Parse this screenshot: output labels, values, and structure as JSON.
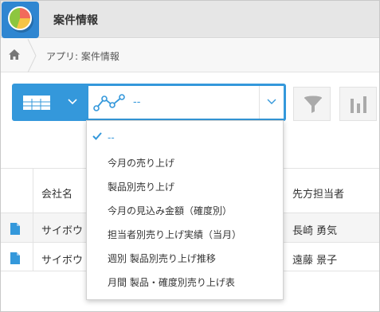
{
  "header": {
    "app_icon": "pie-chart-app-icon",
    "title": "案件情報"
  },
  "breadcrumb": {
    "home_icon": "home-icon",
    "text": "アプリ: 案件情報"
  },
  "toolbar": {
    "view_icon": "table-view-icon",
    "graph_icon": "line-chart-icon",
    "graph_value": "--",
    "filter_icon": "filter-icon",
    "chart_icon": "bar-chart-icon"
  },
  "table": {
    "headers": {
      "company": "会社名",
      "contact": "先方担当者"
    },
    "rows": [
      {
        "company": "サイボウ",
        "contact": "長崎 勇気"
      },
      {
        "company": "サイボウ",
        "contact": "遠藤 景子"
      }
    ]
  },
  "dropdown": {
    "items": [
      {
        "label": "--",
        "selected": true
      },
      {
        "label": "今月の売り上げ"
      },
      {
        "label": "製品別売り上げ"
      },
      {
        "label": "今月の見込み金額（確度別）"
      },
      {
        "label": "担当者別売り上げ実績（当月）"
      },
      {
        "label": "週別 製品別売り上げ推移"
      },
      {
        "label": "月間 製品・確度別売り上げ表"
      }
    ]
  },
  "colors": {
    "accent": "#3498db",
    "header_bg": "#e6e6e6"
  }
}
